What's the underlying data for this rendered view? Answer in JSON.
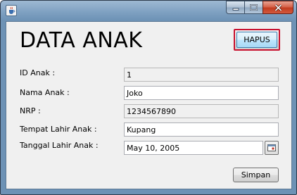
{
  "window": {
    "icon": "java-cup-icon",
    "controls": [
      "minimize-icon",
      "maximize-icon",
      "close-icon"
    ]
  },
  "header": {
    "title": "DATA ANAK",
    "delete_label": "HAPUS"
  },
  "form": {
    "fields": [
      {
        "label": "ID Anak :",
        "value": "1",
        "editable": false
      },
      {
        "label": "Nama Anak :",
        "value": "Joko",
        "editable": true
      },
      {
        "label": "NRP :",
        "value": "1234567890",
        "editable": false
      },
      {
        "label": "Tempat Lahir Anak :",
        "value": "Kupang",
        "editable": true
      },
      {
        "label": "Tanggal Lahir Anak :",
        "value": "May 10, 2005",
        "editable": true
      }
    ],
    "calendar_icon": "calendar-icon"
  },
  "footer": {
    "save_label": "Simpan"
  },
  "colors": {
    "delete_focus_border": "#c8102e",
    "close_button": "#c23b1f"
  }
}
